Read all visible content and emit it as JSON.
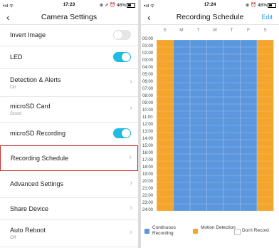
{
  "left_status": {
    "time": "17:23",
    "signal": "•ııl ᯤ",
    "right": "⊕ ➚ ⏰ 48%"
  },
  "settings": {
    "title": "Camera Settings",
    "items": [
      {
        "label": "Invert Image",
        "toggle": "off"
      },
      {
        "label": "LED",
        "toggle": "on"
      },
      {
        "label": "Detection & Alerts",
        "sub": "On"
      },
      {
        "label": "microSD Card",
        "sub": "Good"
      },
      {
        "label": "microSD Recording",
        "toggle": "on"
      },
      {
        "label": "Recording Schedule"
      },
      {
        "label": "Advanced Settings"
      },
      {
        "label": "Share Device"
      },
      {
        "label": "Auto Reboot",
        "sub": "Off"
      }
    ]
  },
  "right_status": {
    "time": "17:24",
    "signal": "•ııl ᯤ",
    "right": "⊕ ⏰ 48%"
  },
  "schedule": {
    "title": "Recording Schedule",
    "edit_label": "Edit",
    "days": [
      "S",
      "M",
      "T",
      "W",
      "T",
      "F",
      "S"
    ],
    "hours": [
      "00:00",
      "01:00",
      "02:00",
      "03:00",
      "04:00",
      "05:00",
      "06:00",
      "07:00",
      "08:00",
      "09:00",
      "10:00",
      "11:00",
      "12:00",
      "13:00",
      "14:00",
      "15:00",
      "16:00",
      "17:00",
      "18:00",
      "19:00",
      "20:00",
      "21:00",
      "22:00",
      "23:00",
      "24:00"
    ],
    "day_modes": [
      "motion",
      "continuous",
      "continuous",
      "continuous",
      "continuous",
      "continuous",
      "motion"
    ],
    "legend": [
      {
        "label": "Continuous Recording",
        "color": "#5c97dd"
      },
      {
        "label": "Motion Detection",
        "color": "#f4a52c"
      },
      {
        "label": "Don't Record",
        "color": "#ffffff"
      }
    ]
  },
  "colors": {
    "continuous": "#5c97dd",
    "motion": "#f4a52c",
    "accent": "#1ebbe2",
    "highlight": "#c9302c"
  }
}
